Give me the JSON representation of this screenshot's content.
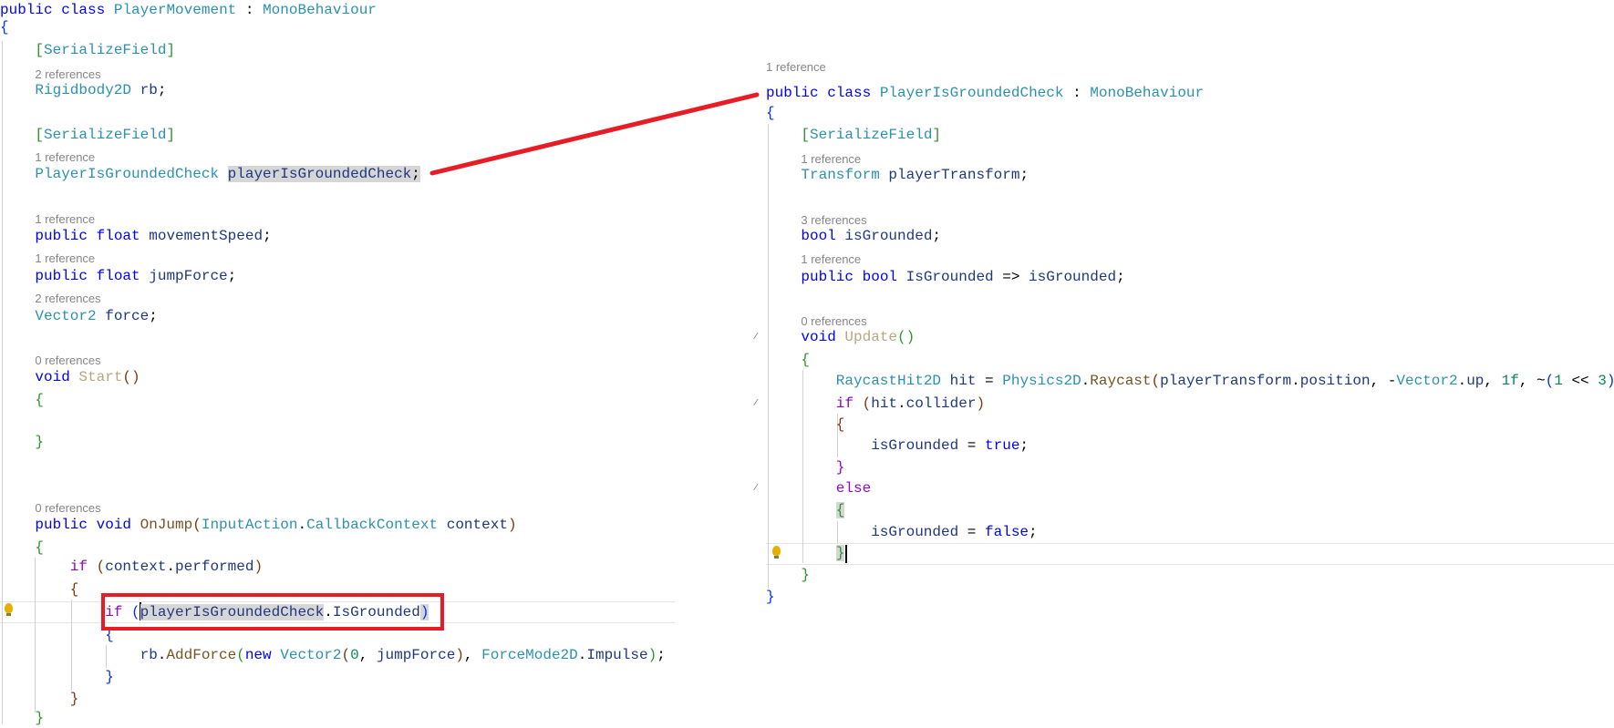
{
  "left_file": {
    "lines": [
      {
        "indent": 0,
        "tokens": [
          {
            "t": "public",
            "c": "kw"
          },
          {
            "t": " "
          },
          {
            "t": "class",
            "c": "kw"
          },
          {
            "t": " "
          },
          {
            "t": "PlayerMovement",
            "c": "type"
          },
          {
            "t": " : "
          },
          {
            "t": "MonoBehaviour",
            "c": "type"
          }
        ]
      },
      {
        "indent": 0,
        "tokens": [
          {
            "t": "{",
            "c": "b1"
          }
        ]
      },
      {
        "indent": 1,
        "tokens": [
          {
            "t": "[",
            "c": "b2"
          },
          {
            "t": "SerializeField",
            "c": "type"
          },
          {
            "t": "]",
            "c": "b2"
          }
        ]
      },
      {
        "indent": 1,
        "lens": "2 references"
      },
      {
        "indent": 1,
        "tokens": [
          {
            "t": "Rigidbody2D",
            "c": "type"
          },
          {
            "t": " "
          },
          {
            "t": "rb",
            "c": "id"
          },
          {
            "t": ";"
          }
        ]
      },
      {
        "indent": 1,
        "tokens": [
          {
            "t": "[",
            "c": "b2"
          },
          {
            "t": "SerializeField",
            "c": "type"
          },
          {
            "t": "]",
            "c": "b2"
          }
        ]
      },
      {
        "indent": 1,
        "lens": "1 reference"
      },
      {
        "indent": 1,
        "tokens": [
          {
            "t": "PlayerIsGroundedCheck",
            "c": "type"
          },
          {
            "t": " "
          },
          {
            "t": "playerIsGroundedCheck",
            "c": "id hl"
          },
          {
            "t": ";",
            "c": "plain hl"
          }
        ]
      },
      {
        "indent": 1,
        "lens": "1 reference"
      },
      {
        "indent": 1,
        "tokens": [
          {
            "t": "public",
            "c": "kw"
          },
          {
            "t": " "
          },
          {
            "t": "float",
            "c": "kw"
          },
          {
            "t": " "
          },
          {
            "t": "movementSpeed",
            "c": "id"
          },
          {
            "t": ";"
          }
        ]
      },
      {
        "indent": 1,
        "lens": "1 reference"
      },
      {
        "indent": 1,
        "tokens": [
          {
            "t": "public",
            "c": "kw"
          },
          {
            "t": " "
          },
          {
            "t": "float",
            "c": "kw"
          },
          {
            "t": " "
          },
          {
            "t": "jumpForce",
            "c": "id"
          },
          {
            "t": ";"
          }
        ]
      },
      {
        "indent": 1,
        "lens": "2 references"
      },
      {
        "indent": 1,
        "tokens": [
          {
            "t": "Vector2",
            "c": "type"
          },
          {
            "t": " "
          },
          {
            "t": "force",
            "c": "id"
          },
          {
            "t": ";"
          }
        ]
      },
      {
        "indent": 1,
        "lens": "0 references"
      },
      {
        "indent": 1,
        "tokens": [
          {
            "t": "void",
            "c": "kw"
          },
          {
            "t": " "
          },
          {
            "t": "Start",
            "c": "unused"
          },
          {
            "t": "()",
            "c": "b3"
          }
        ]
      },
      {
        "indent": 1,
        "tokens": [
          {
            "t": "{",
            "c": "b2"
          }
        ]
      },
      {
        "indent": 1,
        "tokens": [
          {
            "t": "}",
            "c": "b2"
          }
        ]
      },
      {
        "indent": 1,
        "lens": "0 references"
      },
      {
        "indent": 1,
        "tokens": [
          {
            "t": "public",
            "c": "kw"
          },
          {
            "t": " "
          },
          {
            "t": "void",
            "c": "kw"
          },
          {
            "t": " "
          },
          {
            "t": "OnJump",
            "c": "method"
          },
          {
            "t": "(",
            "c": "b3"
          },
          {
            "t": "InputAction",
            "c": "type"
          },
          {
            "t": "."
          },
          {
            "t": "CallbackContext",
            "c": "type"
          },
          {
            "t": " "
          },
          {
            "t": "context",
            "c": "id"
          },
          {
            "t": ")",
            "c": "b3"
          }
        ]
      },
      {
        "indent": 1,
        "tokens": [
          {
            "t": "{",
            "c": "b2"
          }
        ]
      },
      {
        "indent": 2,
        "tokens": [
          {
            "t": "if",
            "c": "ctl"
          },
          {
            "t": " "
          },
          {
            "t": "(",
            "c": "b3"
          },
          {
            "t": "context",
            "c": "id"
          },
          {
            "t": "."
          },
          {
            "t": "performed",
            "c": "id"
          },
          {
            "t": ")",
            "c": "b3"
          }
        ]
      },
      {
        "indent": 2,
        "tokens": [
          {
            "t": "{",
            "c": "b3"
          }
        ]
      },
      {
        "indent": 3,
        "tokens": [
          {
            "t": "if",
            "c": "ctl"
          },
          {
            "t": " "
          },
          {
            "t": "(",
            "c": "b1"
          },
          {
            "t": "playerIsGroundedCheck",
            "c": "id hl"
          },
          {
            "t": "."
          },
          {
            "t": "IsGrounded",
            "c": "id"
          },
          {
            "t": ")",
            "c": "b1 hl"
          }
        ]
      },
      {
        "indent": 3,
        "tokens": [
          {
            "t": "{",
            "c": "b1"
          }
        ]
      },
      {
        "indent": 4,
        "tokens": [
          {
            "t": "rb",
            "c": "id"
          },
          {
            "t": "."
          },
          {
            "t": "AddForce",
            "c": "method"
          },
          {
            "t": "(",
            "c": "b2"
          },
          {
            "t": "new",
            "c": "kw"
          },
          {
            "t": " "
          },
          {
            "t": "Vector2",
            "c": "type"
          },
          {
            "t": "(",
            "c": "b3"
          },
          {
            "t": "0",
            "c": "num"
          },
          {
            "t": ", "
          },
          {
            "t": "jumpForce",
            "c": "id"
          },
          {
            "t": ")",
            "c": "b3"
          },
          {
            "t": ", "
          },
          {
            "t": "ForceMode2D",
            "c": "type"
          },
          {
            "t": "."
          },
          {
            "t": "Impulse",
            "c": "id"
          },
          {
            "t": ")",
            "c": "b2"
          },
          {
            "t": ";"
          }
        ]
      },
      {
        "indent": 3,
        "tokens": [
          {
            "t": "}",
            "c": "b1"
          }
        ]
      },
      {
        "indent": 2,
        "tokens": [
          {
            "t": "}",
            "c": "b3"
          }
        ]
      },
      {
        "indent": 1,
        "tokens": [
          {
            "t": "}",
            "c": "b2"
          }
        ]
      }
    ]
  },
  "right_file": {
    "lines": [
      {
        "indent": 0,
        "lens": "1 reference"
      },
      {
        "indent": 0,
        "tokens": [
          {
            "t": "public",
            "c": "kw"
          },
          {
            "t": " "
          },
          {
            "t": "class",
            "c": "kw"
          },
          {
            "t": " "
          },
          {
            "t": "PlayerIsGroundedCheck",
            "c": "type"
          },
          {
            "t": " : "
          },
          {
            "t": "MonoBehaviour",
            "c": "type"
          }
        ]
      },
      {
        "indent": 0,
        "tokens": [
          {
            "t": "{",
            "c": "b1"
          }
        ]
      },
      {
        "indent": 1,
        "tokens": [
          {
            "t": "[",
            "c": "b2"
          },
          {
            "t": "SerializeField",
            "c": "type"
          },
          {
            "t": "]",
            "c": "b2"
          }
        ]
      },
      {
        "indent": 1,
        "lens": "1 reference"
      },
      {
        "indent": 1,
        "tokens": [
          {
            "t": "Transform",
            "c": "type"
          },
          {
            "t": " "
          },
          {
            "t": "playerTransform",
            "c": "id"
          },
          {
            "t": ";"
          }
        ]
      },
      {
        "indent": 1,
        "lens": "3 references"
      },
      {
        "indent": 1,
        "tokens": [
          {
            "t": "bool",
            "c": "kw"
          },
          {
            "t": " "
          },
          {
            "t": "isGrounded",
            "c": "id"
          },
          {
            "t": ";"
          }
        ]
      },
      {
        "indent": 1,
        "lens": "1 reference"
      },
      {
        "indent": 1,
        "tokens": [
          {
            "t": "public",
            "c": "kw"
          },
          {
            "t": " "
          },
          {
            "t": "bool",
            "c": "kw"
          },
          {
            "t": " "
          },
          {
            "t": "IsGrounded",
            "c": "id"
          },
          {
            "t": " => "
          },
          {
            "t": "isGrounded",
            "c": "id"
          },
          {
            "t": ";"
          }
        ]
      },
      {
        "indent": 1,
        "lens": "0 references"
      },
      {
        "indent": 1,
        "tokens": [
          {
            "t": "void",
            "c": "kw"
          },
          {
            "t": " "
          },
          {
            "t": "Update",
            "c": "unused"
          },
          {
            "t": "()",
            "c": "b2"
          }
        ]
      },
      {
        "indent": 1,
        "tokens": [
          {
            "t": "{",
            "c": "b2"
          }
        ]
      },
      {
        "indent": 2,
        "tokens": [
          {
            "t": "RaycastHit2D",
            "c": "type"
          },
          {
            "t": " "
          },
          {
            "t": "hit",
            "c": "id"
          },
          {
            "t": " = "
          },
          {
            "t": "Physics2D",
            "c": "type"
          },
          {
            "t": "."
          },
          {
            "t": "Raycast",
            "c": "method"
          },
          {
            "t": "(",
            "c": "b3"
          },
          {
            "t": "playerTransform",
            "c": "id"
          },
          {
            "t": "."
          },
          {
            "t": "position",
            "c": "id"
          },
          {
            "t": ", -"
          },
          {
            "t": "Vector2",
            "c": "type"
          },
          {
            "t": "."
          },
          {
            "t": "up",
            "c": "id"
          },
          {
            "t": ", "
          },
          {
            "t": "1f",
            "c": "num"
          },
          {
            "t": ", ~"
          },
          {
            "t": "(",
            "c": "b1"
          },
          {
            "t": "1",
            "c": "num"
          },
          {
            "t": " << "
          },
          {
            "t": "3",
            "c": "num"
          },
          {
            "t": ")",
            "c": "b1"
          }
        ]
      },
      {
        "indent": 2,
        "tokens": [
          {
            "t": "if",
            "c": "ctl"
          },
          {
            "t": " "
          },
          {
            "t": "(",
            "c": "b3"
          },
          {
            "t": "hit",
            "c": "id"
          },
          {
            "t": "."
          },
          {
            "t": "collider",
            "c": "id"
          },
          {
            "t": ")",
            "c": "b3"
          }
        ]
      },
      {
        "indent": 2,
        "tokens": [
          {
            "t": "{",
            "c": "b3"
          }
        ]
      },
      {
        "indent": 3,
        "tokens": [
          {
            "t": "isGrounded",
            "c": "id"
          },
          {
            "t": " = "
          },
          {
            "t": "true",
            "c": "kw"
          },
          {
            "t": ";"
          }
        ]
      },
      {
        "indent": 2,
        "tokens": [
          {
            "t": "}",
            "c": "ctl"
          }
        ]
      },
      {
        "indent": 2,
        "tokens": [
          {
            "t": "else",
            "c": "ctl"
          }
        ]
      },
      {
        "indent": 2,
        "tokens": [
          {
            "t": "{",
            "c": "b2 hl"
          }
        ]
      },
      {
        "indent": 3,
        "tokens": [
          {
            "t": "isGrounded",
            "c": "id"
          },
          {
            "t": " = "
          },
          {
            "t": "false",
            "c": "kw"
          },
          {
            "t": ";"
          }
        ]
      },
      {
        "indent": 2,
        "tokens": [
          {
            "t": "}",
            "c": "b2 hl"
          }
        ]
      },
      {
        "indent": 1,
        "tokens": [
          {
            "t": "}",
            "c": "b2"
          }
        ]
      },
      {
        "indent": 0,
        "tokens": [
          {
            "t": "}",
            "c": "b1"
          }
        ]
      }
    ]
  },
  "annotation": {
    "box_color": "#e81c24",
    "arrow_color": "#e81c24"
  }
}
